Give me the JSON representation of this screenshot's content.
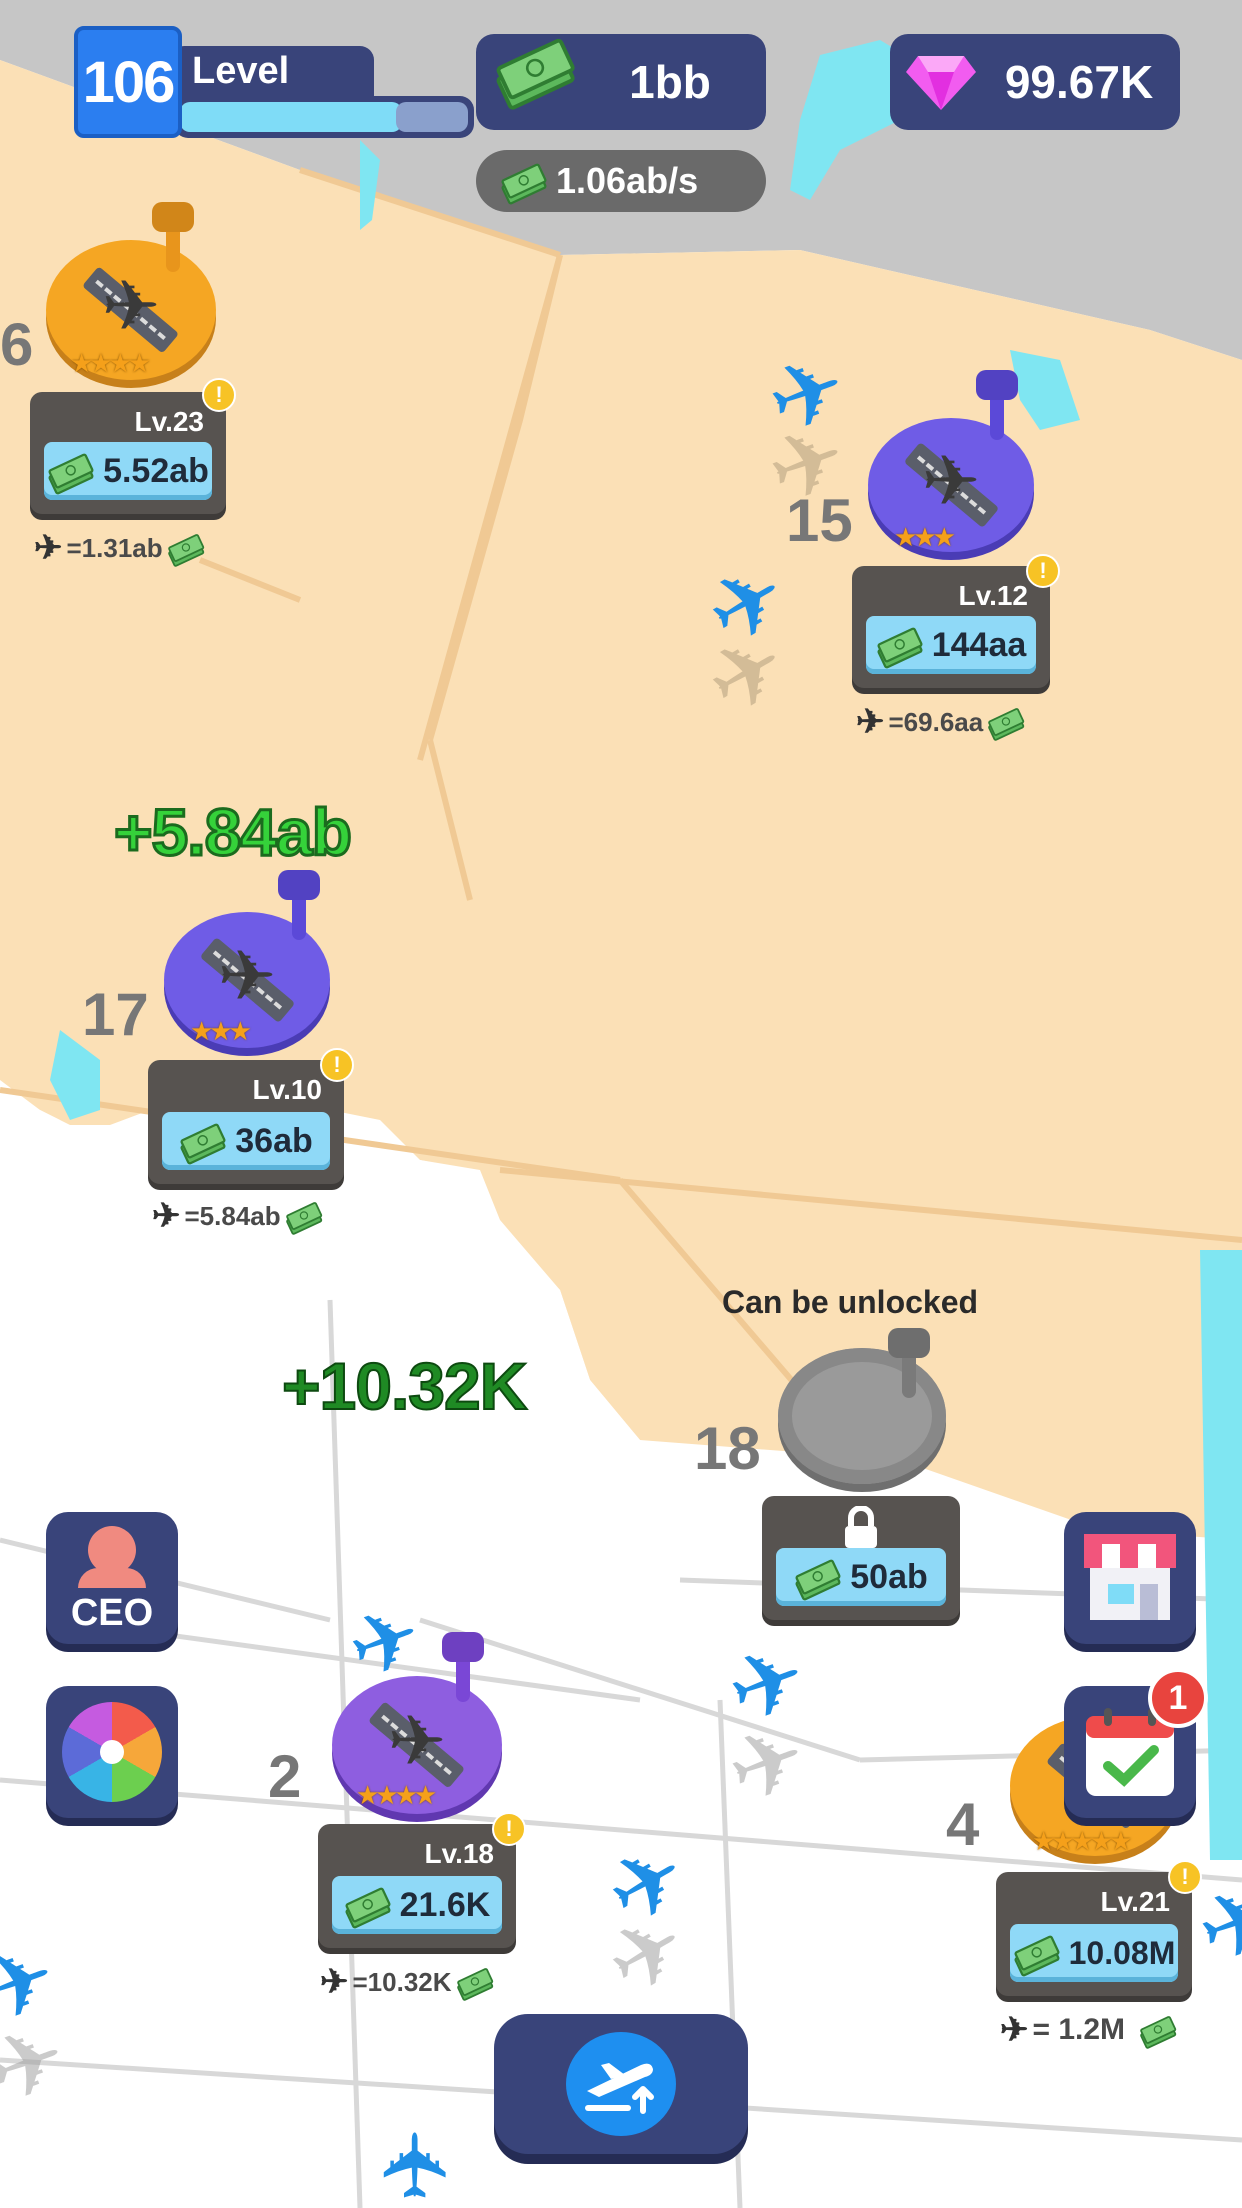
{
  "hud": {
    "level_number": "106",
    "level_label": "Level",
    "level_progress": 0.74,
    "cash": "1bb",
    "cash_rate": "1.06ab/s",
    "gems": "99.67K",
    "cash_icon": "cash-stack-icon",
    "gem_icon": "diamond-icon"
  },
  "airports": [
    {
      "number": "6",
      "level": "Lv.23",
      "cost": "5.52ab",
      "income": "=1.31ab",
      "color": "#f5a623",
      "stars": 4
    },
    {
      "number": "15",
      "level": "Lv.12",
      "cost": "144aa",
      "income": "=69.6aa",
      "color": "#6f5ce6",
      "stars": 3
    },
    {
      "number": "17",
      "level": "Lv.10",
      "cost": "36ab",
      "income": "=5.84ab",
      "color": "#6f5ce6",
      "stars": 3
    },
    {
      "number": "2",
      "level": "Lv.18",
      "cost": "21.6K",
      "income": "=10.32K",
      "color": "#8e5ee0",
      "stars": 4
    },
    {
      "number": "4",
      "level": "Lv.21",
      "cost": "10.08M",
      "income": "= 1.2M",
      "color": "#f5a623",
      "stars": 5
    },
    {
      "number": "18",
      "locked_label": "Can be unlocked",
      "cost": "50ab",
      "color": "#9a9a9a"
    }
  ],
  "floating_earnings": [
    "+5.84ab",
    "+10.32K"
  ],
  "buttons": {
    "ceo": "CEO",
    "wheel": "spin-wheel-icon",
    "shop": "shop-icon",
    "calendar": "calendar-check-icon",
    "calendar_badge": "1",
    "takeoff": "takeoff-icon"
  },
  "colors": {
    "hud_panel": "#39447a",
    "land_us": "#fbe0b6",
    "land_canada": "#c6c6c6",
    "water": "#7fe6f2",
    "plane_blue": "#1f8fe6",
    "earning_green": "#35d23a"
  }
}
